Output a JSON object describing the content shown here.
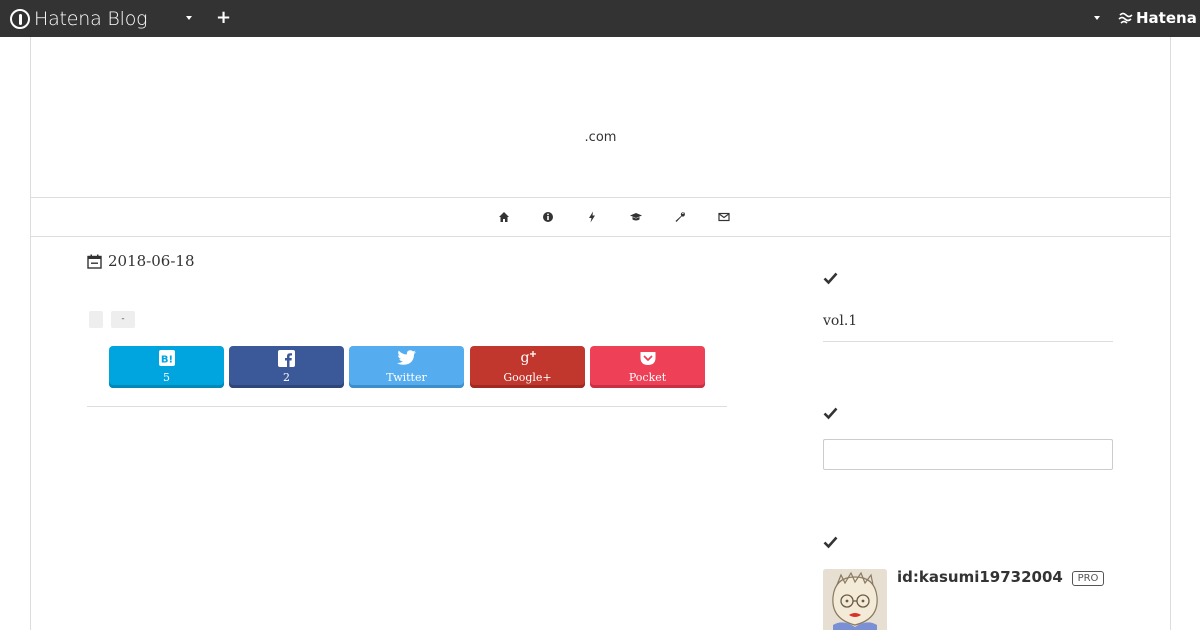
{
  "topbar": {
    "brand": "Hatena Blog",
    "plus_label": "+",
    "hatena_label": "Hatena"
  },
  "header": {
    "site_title": ".com"
  },
  "nav": {
    "icons": [
      "home-icon",
      "info-icon",
      "bolt-icon",
      "graduation-cap-icon",
      "wrench-icon",
      "envelope-icon"
    ]
  },
  "article": {
    "date": "2018-06-18",
    "category_b": "-"
  },
  "share": {
    "hatena_count": "5",
    "facebook_count": "2",
    "twitter_label": "Twitter",
    "googleplus_label": "Google+",
    "pocket_label": "Pocket"
  },
  "sidebar": {
    "section1_text": "vol.1",
    "profile_id": "id:kasumi19732004",
    "pro_badge": "PRO"
  },
  "colors": {
    "topbar": "#333333",
    "hatena": "#00a4de",
    "facebook": "#3b5998",
    "twitter": "#55acee",
    "googleplus": "#c1362d",
    "pocket": "#ee4056"
  }
}
